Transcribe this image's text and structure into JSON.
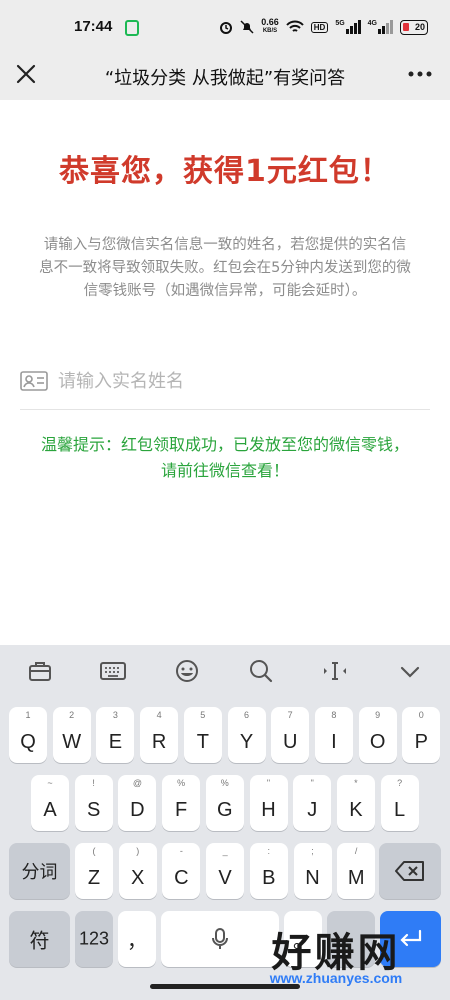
{
  "status_bar": {
    "time": "17:44",
    "net_speed_value": "0.66",
    "net_speed_unit": "KB/S",
    "hd_label": "HD",
    "sig1_label": "5G",
    "sig2_label": "4G",
    "battery": "20",
    "battery_color": "#e0323a"
  },
  "title_bar": {
    "title": "“垃圾分类 从我做起”有奖问答",
    "close_icon": "close-icon",
    "more_icon": "more-icon"
  },
  "page": {
    "headline": "恭喜您，获得1元红包！",
    "headline_color": "#d03a2b",
    "notice": "请输入与您微信实名信息一致的姓名，若您提供的实名信息不一致将导致领取失败。红包会在5分钟内发送到您的微信零钱账号（如遇微信异常，可能会延时）。",
    "name_placeholder": "请输入实名姓名",
    "name_value": "",
    "tip": "温馨提示：红包领取成功，已发放至您的微信零钱， 请前往微信查看！",
    "tip_color": "#2aa43c"
  },
  "keyboard": {
    "toolbar": [
      "briefcase-icon",
      "keyboard-icon",
      "emoji-icon",
      "search-icon",
      "cursor-icon",
      "collapse-icon"
    ],
    "row1": [
      {
        "k": "Q",
        "s": "1"
      },
      {
        "k": "W",
        "s": "2"
      },
      {
        "k": "E",
        "s": "3"
      },
      {
        "k": "R",
        "s": "4"
      },
      {
        "k": "T",
        "s": "5"
      },
      {
        "k": "Y",
        "s": "6"
      },
      {
        "k": "U",
        "s": "7"
      },
      {
        "k": "I",
        "s": "8"
      },
      {
        "k": "O",
        "s": "9"
      },
      {
        "k": "P",
        "s": "0"
      }
    ],
    "row2": [
      {
        "k": "A",
        "s": "~"
      },
      {
        "k": "S",
        "s": "!"
      },
      {
        "k": "D",
        "s": "@"
      },
      {
        "k": "F",
        "s": "%"
      },
      {
        "k": "G",
        "s": "%"
      },
      {
        "k": "H",
        "s": "\""
      },
      {
        "k": "J",
        "s": "\""
      },
      {
        "k": "K",
        "s": "*"
      },
      {
        "k": "L",
        "s": "?"
      }
    ],
    "row3_left": "分词",
    "row3": [
      {
        "k": "Z",
        "s": "("
      },
      {
        "k": "X",
        "s": ")"
      },
      {
        "k": "C",
        "s": "-"
      },
      {
        "k": "V",
        "s": "_"
      },
      {
        "k": "B",
        "s": ":"
      },
      {
        "k": "N",
        "s": ";"
      },
      {
        "k": "M",
        "s": "/"
      }
    ],
    "row4": {
      "symbols": "符",
      "numbers": "123",
      "comma": "，",
      "period": "。",
      "space_icon": "mic-icon"
    }
  },
  "watermark": {
    "text": "好赚网",
    "url": "www.zhuanyes.com"
  }
}
